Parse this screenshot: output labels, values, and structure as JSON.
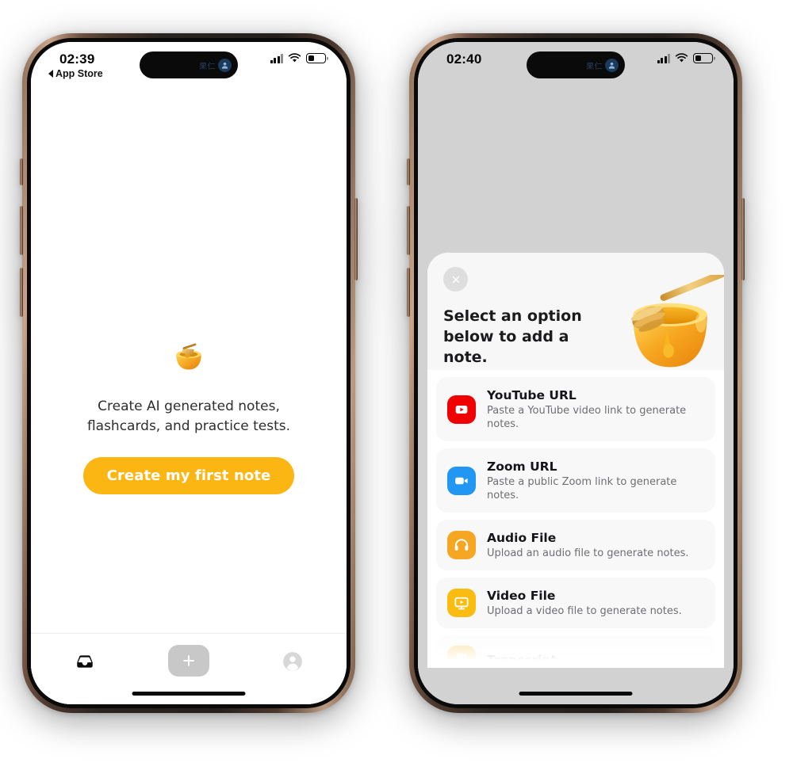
{
  "colors": {
    "accent": "#fbb614",
    "youtube_red": "#f00000",
    "zoom_blue": "#2196f3",
    "audio_orange": "#f5a623",
    "video_yellow": "#fbbc12",
    "sheet_bg": "#ffffff",
    "phone2_bg": "#d2d2d2"
  },
  "phone1": {
    "status": {
      "time": "02:39",
      "back_label": "App Store",
      "island_text": "果仁",
      "island_icon": "person-badge-icon",
      "signal_icon": "cellular-bars-icon",
      "wifi_icon": "wifi-icon",
      "battery_icon": "battery-icon"
    },
    "empty_state": {
      "illustration": "honey-pot-emoji",
      "line1": "Create AI generated notes,",
      "line2": "flashcards, and practice tests.",
      "cta_label": "Create my first note"
    },
    "tabbar": {
      "items": [
        {
          "name": "inbox-tab",
          "icon": "inbox-tray-icon"
        },
        {
          "name": "add-tab",
          "icon": "plus-icon"
        },
        {
          "name": "profile-tab",
          "icon": "person-circle-icon"
        }
      ]
    }
  },
  "phone2": {
    "status": {
      "time": "02:40",
      "island_text": "果仁",
      "island_icon": "person-badge-icon",
      "signal_icon": "cellular-bars-icon",
      "wifi_icon": "wifi-icon",
      "battery_icon": "battery-icon"
    },
    "sheet": {
      "close_icon": "close-x-icon",
      "title": "Select an option\nbelow to add a note.",
      "illustration": "honey-pot-with-dipper",
      "options": [
        {
          "icon": "youtube-icon",
          "title": "YouTube URL",
          "desc": "Paste a YouTube video link to generate notes.",
          "faded": false
        },
        {
          "icon": "zoom-video-icon",
          "title": "Zoom URL",
          "desc": "Paste a public Zoom link to generate notes.",
          "faded": false
        },
        {
          "icon": "headphones-icon",
          "title": "Audio File",
          "desc": "Upload an audio file to generate notes.",
          "faded": false
        },
        {
          "icon": "video-monitor-icon",
          "title": "Video File",
          "desc": "Upload a video file to generate notes.",
          "faded": false
        },
        {
          "icon": "transcript-icon",
          "title": "Transcript",
          "desc": "",
          "faded": true
        }
      ]
    }
  }
}
